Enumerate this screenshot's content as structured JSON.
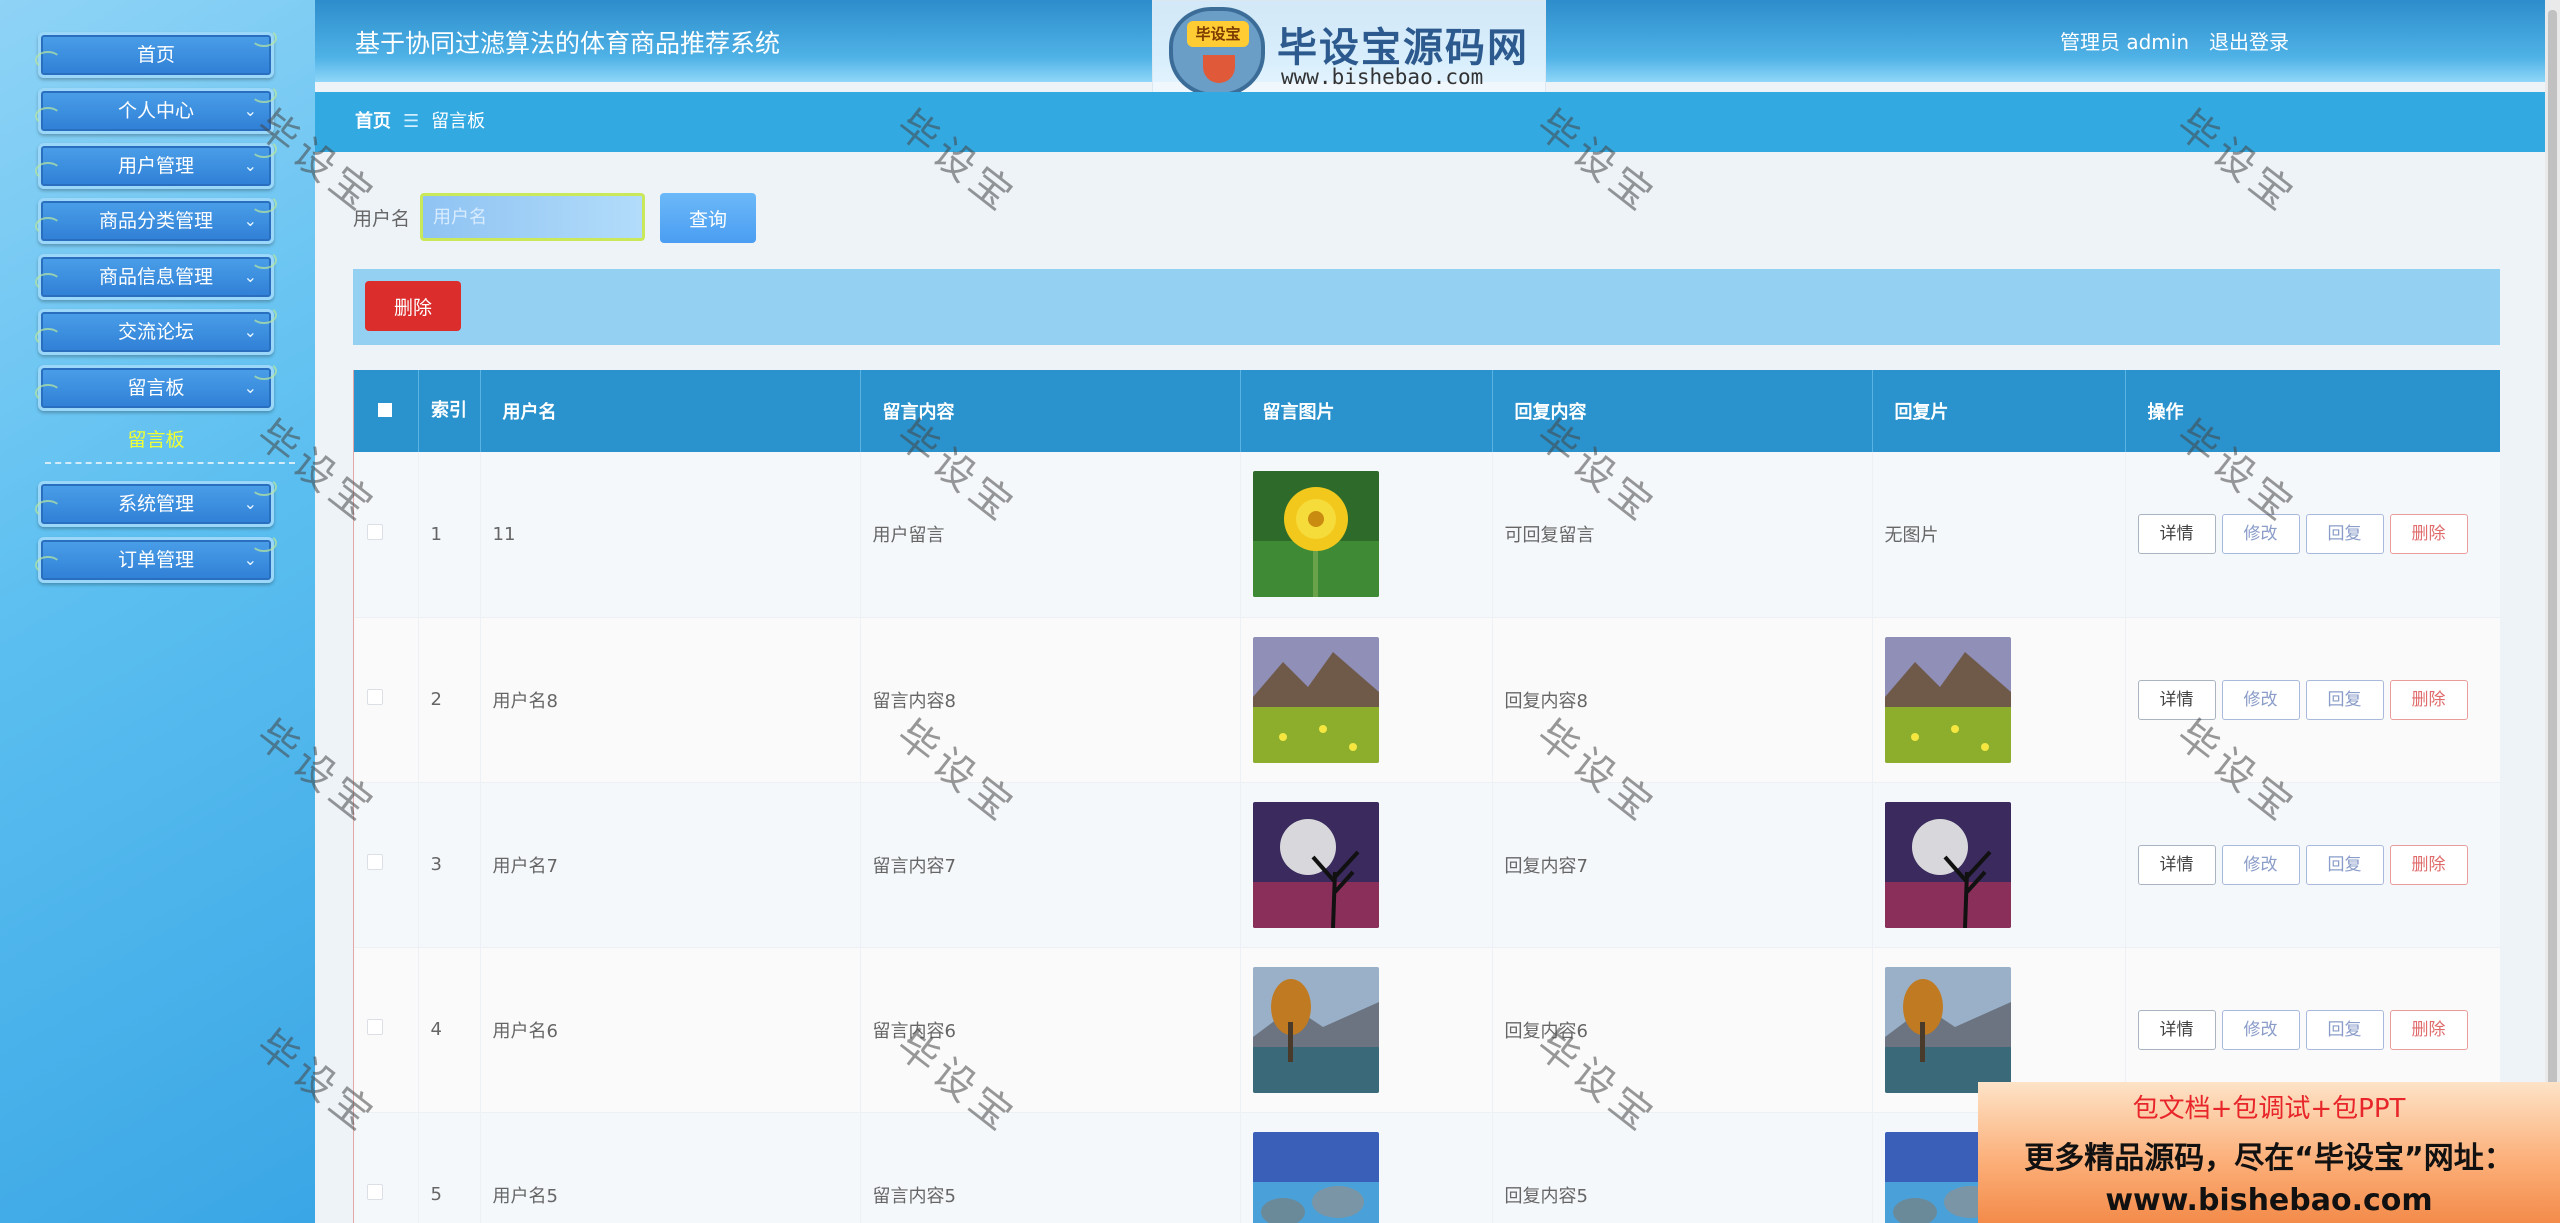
{
  "sidebar": {
    "items": [
      {
        "label": "首页"
      },
      {
        "label": "个人中心"
      },
      {
        "label": "用户管理"
      },
      {
        "label": "商品分类管理"
      },
      {
        "label": "商品信息管理"
      },
      {
        "label": "交流论坛"
      },
      {
        "label": "留言板"
      },
      {
        "label": "系统管理"
      },
      {
        "label": "订单管理"
      }
    ],
    "active_sub": "留言板"
  },
  "header": {
    "title": "基于协同过滤算法的体育商品推荐系统",
    "user_text": "管理员 admin",
    "logout": "退出登录"
  },
  "watermark_logo": {
    "badge": "毕设宝",
    "title": "毕设宝源码网",
    "url": "www.bishebao.com"
  },
  "breadcrumb": {
    "home": "首页",
    "sep": "☰",
    "current": "留言板"
  },
  "search": {
    "label": "用户名",
    "placeholder": "用户名",
    "value": "",
    "query_button": "查询"
  },
  "toolbar": {
    "delete_button": "删除"
  },
  "table": {
    "headers": {
      "index": "索引",
      "username": "用户名",
      "content": "留言内容",
      "image": "留言图片",
      "reply": "回复内容",
      "reply_image": "回复片",
      "actions": "操作"
    },
    "rows": [
      {
        "index": "1",
        "username": "11",
        "content": "用户留言",
        "image": "dandelion",
        "reply": "可回复留言",
        "reply_image": "无图片"
      },
      {
        "index": "2",
        "username": "用户名8",
        "content": "留言内容8",
        "image": "meadow",
        "reply": "回复内容8",
        "reply_image": "meadow"
      },
      {
        "index": "3",
        "username": "用户名7",
        "content": "留言内容7",
        "image": "moon",
        "reply": "回复内容7",
        "reply_image": "moon"
      },
      {
        "index": "4",
        "username": "用户名6",
        "content": "留言内容6",
        "image": "lake",
        "reply": "回复内容6",
        "reply_image": "lake"
      },
      {
        "index": "5",
        "username": "用户名5",
        "content": "留言内容5",
        "image": "rocks",
        "reply": "回复内容5",
        "reply_image": "rocks"
      }
    ],
    "actions": {
      "detail": "详情",
      "edit": "修改",
      "reply": "回复",
      "delete": "删除"
    }
  },
  "watermark_text": "毕设宝",
  "promo": {
    "line1": "包文档+包调试+包PPT",
    "line2": "更多精品源码，尽在“毕设宝”网址：",
    "line3": "www.bishebao.com"
  }
}
